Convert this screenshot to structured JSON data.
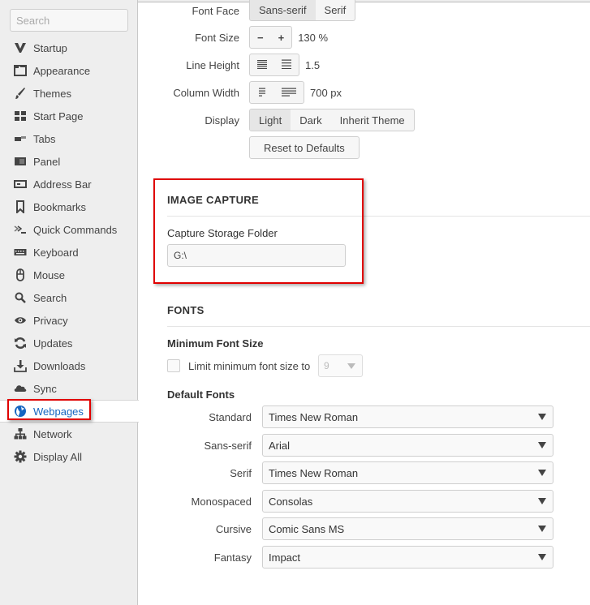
{
  "sidebar": {
    "search_placeholder": "Search",
    "items": [
      {
        "label": "Startup",
        "icon": "vivaldi-v-icon"
      },
      {
        "label": "Appearance",
        "icon": "window-icon"
      },
      {
        "label": "Themes",
        "icon": "brush-icon"
      },
      {
        "label": "Start Page",
        "icon": "grid-icon"
      },
      {
        "label": "Tabs",
        "icon": "tabs-icon"
      },
      {
        "label": "Panel",
        "icon": "panel-icon"
      },
      {
        "label": "Address Bar",
        "icon": "address-bar-icon"
      },
      {
        "label": "Bookmarks",
        "icon": "bookmark-icon"
      },
      {
        "label": "Quick Commands",
        "icon": "quick-commands-icon"
      },
      {
        "label": "Keyboard",
        "icon": "keyboard-icon"
      },
      {
        "label": "Mouse",
        "icon": "mouse-icon"
      },
      {
        "label": "Search",
        "icon": "search-icon"
      },
      {
        "label": "Privacy",
        "icon": "eye-icon"
      },
      {
        "label": "Updates",
        "icon": "refresh-icon"
      },
      {
        "label": "Downloads",
        "icon": "download-icon"
      },
      {
        "label": "Sync",
        "icon": "cloud-icon"
      },
      {
        "label": "Webpages",
        "icon": "globe-icon",
        "active": true
      },
      {
        "label": "Network",
        "icon": "network-icon"
      },
      {
        "label": "Display All",
        "icon": "gear-icon"
      }
    ],
    "active_color": "#1565c0"
  },
  "reader": {
    "font_face": {
      "label": "Font Face",
      "options": [
        "Sans-serif",
        "Serif"
      ],
      "selected": "Sans-serif"
    },
    "font_size": {
      "label": "Font Size",
      "decrease": "−",
      "increase": "+",
      "value": "130 %"
    },
    "line_height": {
      "label": "Line Height",
      "value": "1.5"
    },
    "column_width": {
      "label": "Column Width",
      "value": "700 px"
    },
    "display": {
      "label": "Display",
      "options": [
        "Light",
        "Dark",
        "Inherit Theme"
      ],
      "selected": "Light"
    },
    "reset_label": "Reset to Defaults"
  },
  "image_capture": {
    "title": "IMAGE CAPTURE",
    "folder_label": "Capture Storage Folder",
    "folder_value": "G:\\"
  },
  "fonts": {
    "title": "FONTS",
    "min_size_title": "Minimum Font Size",
    "min_checkbox_label": "Limit minimum font size to",
    "min_checked": false,
    "min_value": "9",
    "default_fonts_title": "Default Fonts",
    "defaults": [
      {
        "label": "Standard",
        "value": "Times New Roman"
      },
      {
        "label": "Sans-serif",
        "value": "Arial"
      },
      {
        "label": "Serif",
        "value": "Times New Roman"
      },
      {
        "label": "Monospaced",
        "value": "Consolas"
      },
      {
        "label": "Cursive",
        "value": "Comic Sans MS"
      },
      {
        "label": "Fantasy",
        "value": "Impact"
      }
    ]
  },
  "highlight_color": "#e00000"
}
